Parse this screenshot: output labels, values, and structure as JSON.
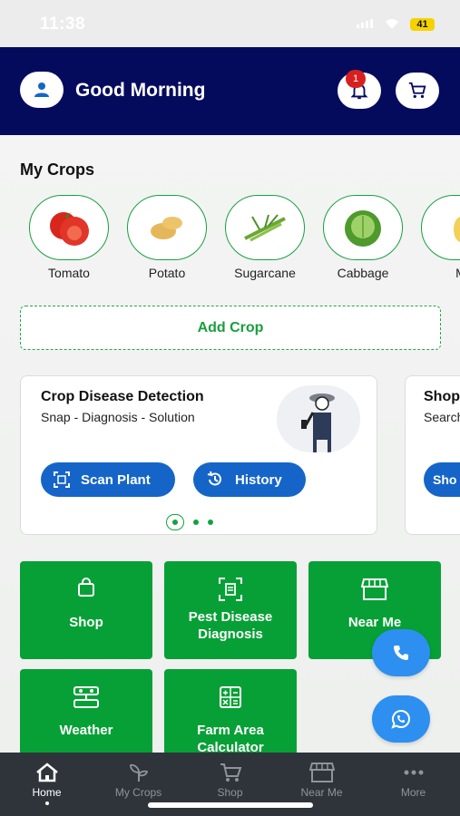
{
  "status_bar": {
    "time": "11:38",
    "battery": "41"
  },
  "header": {
    "greeting": "Good Morning",
    "notification_count": "1"
  },
  "my_crops": {
    "title": "My Crops",
    "items": [
      {
        "label": "Tomato",
        "icon": "tomato-icon"
      },
      {
        "label": "Potato",
        "icon": "potato-icon"
      },
      {
        "label": "Sugarcane",
        "icon": "sugarcane-icon"
      },
      {
        "label": "Cabbage",
        "icon": "cabbage-icon"
      },
      {
        "label": "M",
        "icon": "crop-icon"
      }
    ],
    "add_label": "Add Crop"
  },
  "carousel": {
    "cards": [
      {
        "title": "Crop Disease Detection",
        "subtitle": "Snap - Diagnosis - Solution",
        "buttons": [
          "Scan Plant",
          "History"
        ]
      },
      {
        "title": "Shop",
        "subtitle": "Search",
        "buttons": [
          "Sho"
        ]
      }
    ],
    "active_index": 0,
    "page_count": 3
  },
  "tiles": [
    {
      "label": "Shop",
      "icon": "shopping-bag-icon"
    },
    {
      "label": "Pest Disease Diagnosis",
      "icon": "scan-icon"
    },
    {
      "label": "Near Me",
      "icon": "store-icon"
    },
    {
      "label": "Weather",
      "icon": "weather-station-icon"
    },
    {
      "label": "Farm Area Calculator",
      "icon": "calculator-icon"
    }
  ],
  "fabs": {
    "call_icon": "phone-icon",
    "chat_icon": "whatsapp-icon"
  },
  "bottom_nav": [
    {
      "label": "Home",
      "icon": "home-icon",
      "active": true
    },
    {
      "label": "My Crops",
      "icon": "sprout-icon",
      "active": false
    },
    {
      "label": "Shop",
      "icon": "cart-icon",
      "active": false
    },
    {
      "label": "Near Me",
      "icon": "store-icon",
      "active": false
    },
    {
      "label": "More",
      "icon": "more-icon",
      "active": false
    }
  ],
  "colors": {
    "header_bg": "#050b5c",
    "brand_green": "#07a036",
    "button_blue": "#1565c9",
    "fab_blue": "#2d8ff0",
    "nav_bg": "#2f343a"
  }
}
